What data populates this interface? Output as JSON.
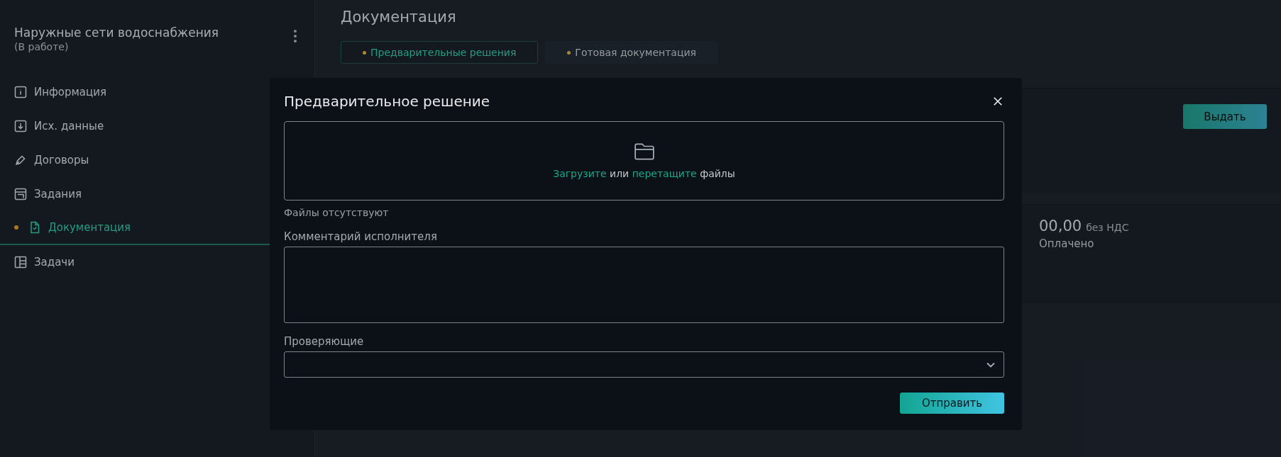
{
  "sidebar": {
    "title": "Наружные сети водоснабжения",
    "status": "(В работе)",
    "items": [
      {
        "label": "Информация",
        "selected": false
      },
      {
        "label": "Исх. данные",
        "selected": false
      },
      {
        "label": "Договоры",
        "selected": false
      },
      {
        "label": "Задания",
        "selected": false
      },
      {
        "label": "Документация",
        "selected": true
      },
      {
        "label": "Задачи",
        "selected": false
      }
    ]
  },
  "page": {
    "title": "Документация",
    "tabs": [
      {
        "label": "Предварительные решения",
        "selected": true
      },
      {
        "label": "Готовая документация",
        "selected": false
      }
    ],
    "issue_button": "Выдать",
    "amount": "00,00",
    "amount_note": "без НДС",
    "payment_status": "Оплачено"
  },
  "modal": {
    "title": "Предварительное решение",
    "upload_hint": [
      {
        "text": "Загрузите",
        "kind": "link"
      },
      {
        "text": "или",
        "kind": "text"
      },
      {
        "text": "перетащите",
        "kind": "link"
      },
      {
        "text": "файлы",
        "kind": "text"
      }
    ],
    "files_status": "Файлы отсутствуют",
    "comment_label": "Комментарий исполнителя",
    "reviewers_label": "Проверяющие",
    "submit": "Отправить"
  }
}
